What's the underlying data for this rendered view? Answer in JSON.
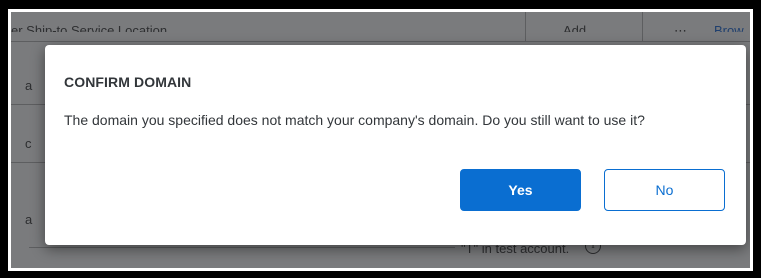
{
  "background": {
    "header_text": "er Ship-to    Service Location",
    "add_label": "Add",
    "browse_label": "Brow",
    "left_fragments": [
      "a",
      "c",
      "a"
    ],
    "test_account_note": "\"T\" in test account."
  },
  "dialog": {
    "title": "CONFIRM DOMAIN",
    "message": "The domain you specified does not match your company's domain. Do you still want to use it?",
    "yes_label": "Yes",
    "no_label": "No"
  },
  "colors": {
    "primary": "#0a6ed1",
    "overlay": "#7a7b7d",
    "text": "#32363a"
  }
}
